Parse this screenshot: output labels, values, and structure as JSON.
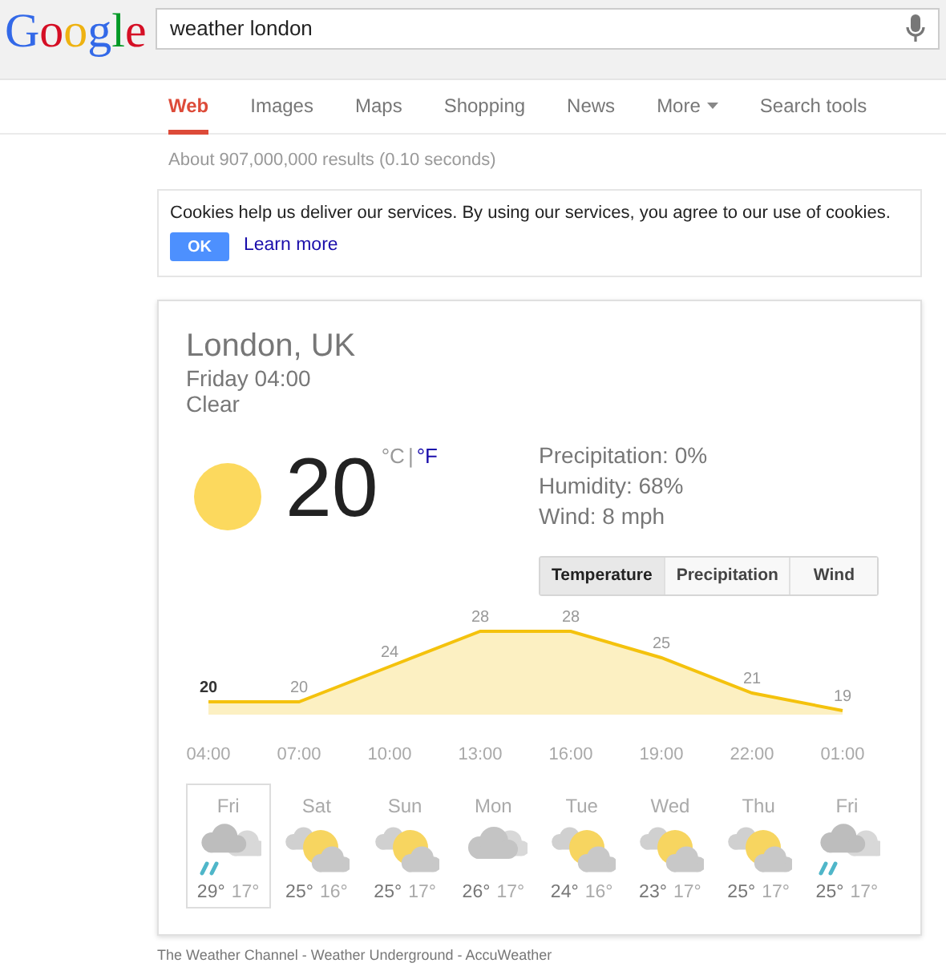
{
  "header": {
    "logo": "Google",
    "search": {
      "value": "weather london"
    }
  },
  "tabs": [
    {
      "label": "Web",
      "selected": true
    },
    {
      "label": "Images",
      "selected": false
    },
    {
      "label": "Maps",
      "selected": false
    },
    {
      "label": "Shopping",
      "selected": false
    },
    {
      "label": "News",
      "selected": false
    },
    {
      "label": "More",
      "selected": false,
      "kind": "dropdown"
    },
    {
      "label": "Search tools",
      "selected": false
    }
  ],
  "result_stats": "About 907,000,000 results (0.10 seconds)",
  "cookie_notice": {
    "text": "Cookies help us deliver our services. By using our services, you agree to our use of cookies.",
    "ok": "OK",
    "learn_more": "Learn more"
  },
  "weather": {
    "location": "London, UK",
    "time": "Friday 04:00",
    "condition": "Clear",
    "temperature": "20",
    "units": [
      {
        "label": "°C",
        "selected": true
      },
      {
        "label": "°F",
        "selected": false
      }
    ],
    "unit_separator": "|",
    "details": [
      "Precipitation: 0%",
      "Humidity: 68%",
      "Wind: 8 mph"
    ],
    "chart_tabs": [
      {
        "label": "Temperature",
        "selected": true
      },
      {
        "label": "Precipitation",
        "selected": false
      },
      {
        "label": "Wind",
        "selected": false
      }
    ],
    "chart_data": {
      "type": "area",
      "categories": [
        "04:00",
        "07:00",
        "10:00",
        "13:00",
        "16:00",
        "19:00",
        "22:00",
        "01:00"
      ],
      "series": [
        {
          "color": "#f4c20d",
          "values": [
            20,
            20,
            24,
            28,
            28,
            25,
            21,
            19
          ]
        }
      ],
      "data_labels": true
    },
    "days": [
      {
        "day": "Fri",
        "kind": "rain",
        "high": "29°",
        "low": "17°",
        "selected": true
      },
      {
        "day": "Sat",
        "kind": "partly-sunny",
        "high": "25°",
        "low": "16°",
        "selected": false
      },
      {
        "day": "Sun",
        "kind": "partly-sunny",
        "high": "25°",
        "low": "17°",
        "selected": false
      },
      {
        "day": "Mon",
        "kind": "cloudy",
        "high": "26°",
        "low": "17°",
        "selected": false
      },
      {
        "day": "Tue",
        "kind": "partly-sunny",
        "high": "24°",
        "low": "16°",
        "selected": false
      },
      {
        "day": "Wed",
        "kind": "partly-sunny",
        "high": "23°",
        "low": "17°",
        "selected": false
      },
      {
        "day": "Thu",
        "kind": "partly-sunny",
        "high": "25°",
        "low": "17°",
        "selected": false
      },
      {
        "day": "Fri",
        "kind": "rain",
        "high": "25°",
        "low": "17°",
        "selected": false
      }
    ]
  },
  "attribution": "The Weather Channel - Weather Underground - AccuWeather"
}
